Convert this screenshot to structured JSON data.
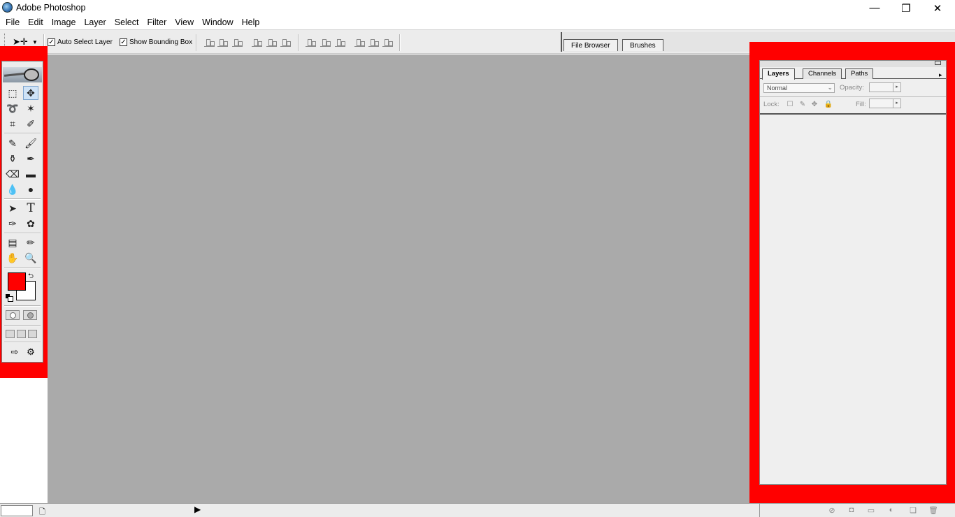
{
  "window": {
    "title": "Adobe Photoshop",
    "minimize_glyph": "—",
    "maximize_glyph": "❐",
    "close_glyph": "✕"
  },
  "menu": [
    "File",
    "Edit",
    "Image",
    "Layer",
    "Select",
    "Filter",
    "View",
    "Window",
    "Help"
  ],
  "options_bar": {
    "auto_select_label": "Auto Select Layer",
    "auto_select_checked": true,
    "bounding_box_label": "Show Bounding Box",
    "bounding_box_checked": true,
    "check_glyph": "✓"
  },
  "palette_well": {
    "tabs": [
      "File Browser",
      "Brushes"
    ]
  },
  "toolbox": {
    "foreground_color": "#ff0000",
    "background_color": "#ffffff",
    "tools": [
      {
        "name": "marquee-tool",
        "glyph": "⬚"
      },
      {
        "name": "move-tool",
        "glyph": "✥",
        "active": true
      },
      {
        "name": "lasso-tool",
        "glyph": "➰"
      },
      {
        "name": "magic-wand-tool",
        "glyph": "✶"
      },
      {
        "name": "crop-tool",
        "glyph": "⌗"
      },
      {
        "name": "slice-tool",
        "glyph": "✐"
      },
      {
        "name": "healing-brush-tool",
        "glyph": "✎"
      },
      {
        "name": "brush-tool",
        "glyph": "🖌"
      },
      {
        "name": "clone-stamp-tool",
        "glyph": "⚱"
      },
      {
        "name": "history-brush-tool",
        "glyph": "✒"
      },
      {
        "name": "eraser-tool",
        "glyph": "⌫"
      },
      {
        "name": "gradient-tool",
        "glyph": "▬"
      },
      {
        "name": "blur-tool",
        "glyph": "💧"
      },
      {
        "name": "dodge-tool",
        "glyph": "●"
      },
      {
        "name": "path-selection-tool",
        "glyph": "➤"
      },
      {
        "name": "type-tool",
        "glyph": "T"
      },
      {
        "name": "pen-tool",
        "glyph": "✑"
      },
      {
        "name": "custom-shape-tool",
        "glyph": "✿"
      },
      {
        "name": "notes-tool",
        "glyph": "▤"
      },
      {
        "name": "eyedropper-tool",
        "glyph": "✏"
      },
      {
        "name": "hand-tool",
        "glyph": "✋"
      },
      {
        "name": "zoom-tool",
        "glyph": "🔍"
      }
    ]
  },
  "layers_palette": {
    "tabs": [
      {
        "label": "Layers",
        "active": true
      },
      {
        "label": "Channels",
        "active": false
      },
      {
        "label": "Paths",
        "active": false
      }
    ],
    "blend_mode": "Normal",
    "opacity_label": "Opacity:",
    "lock_label": "Lock:",
    "fill_label": "Fill:",
    "footer_icons": [
      "layer-style-icon",
      "mask-icon",
      "new-set-icon",
      "adjustment-layer-icon",
      "new-layer-icon",
      "trash-icon"
    ]
  }
}
